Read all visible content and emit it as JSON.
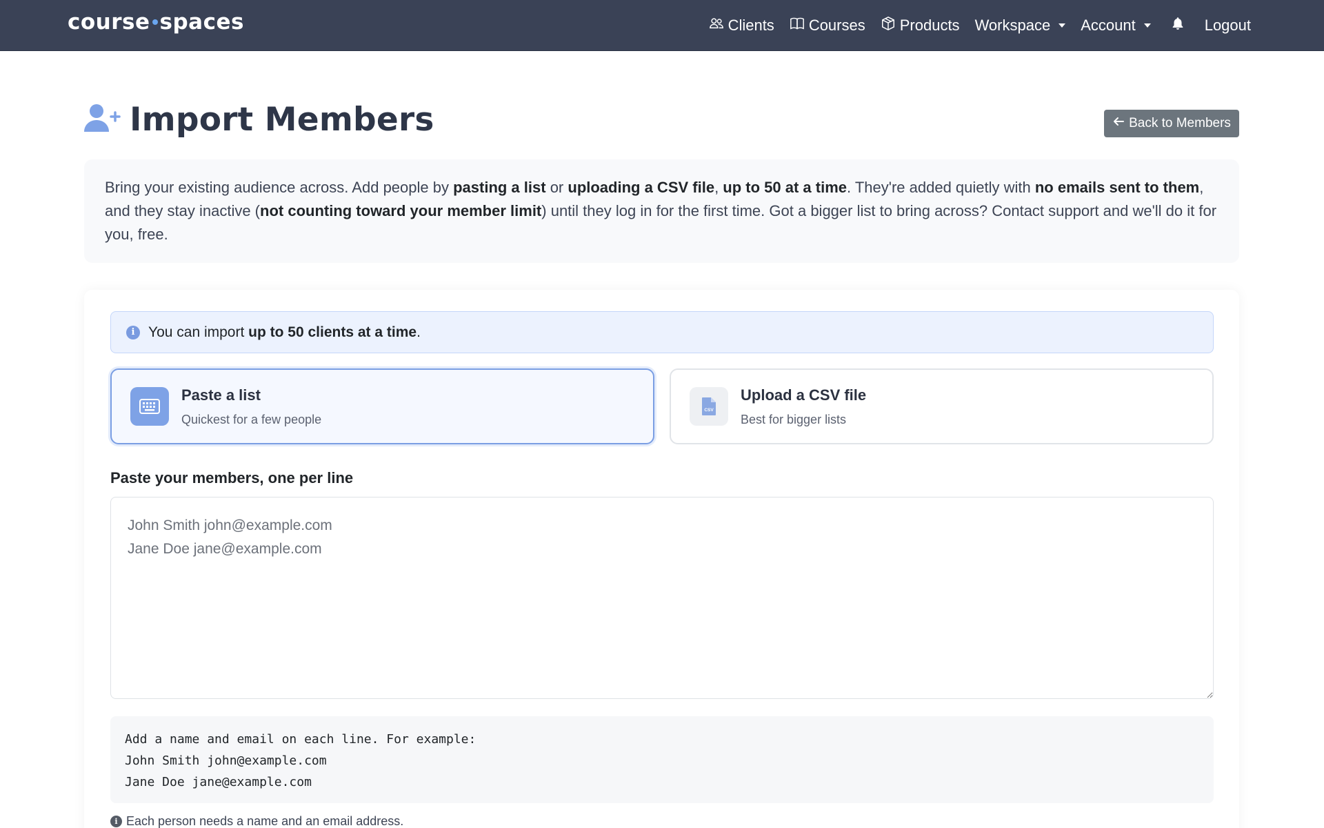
{
  "brand": {
    "left": "course",
    "right": "spaces"
  },
  "nav": {
    "clients": "Clients",
    "courses": "Courses",
    "products": "Products",
    "workspace": "Workspace",
    "account": "Account",
    "logout": "Logout"
  },
  "page": {
    "title": "Import Members",
    "back_label": "Back to Members"
  },
  "intro": {
    "t1": "Bring your existing audience across. Add people by ",
    "b1": "pasting a list",
    "t2": " or ",
    "b2": "uploading a CSV file",
    "t3": ", ",
    "b3": "up to 50 at a time",
    "t4": ". They're added quietly with ",
    "b4": "no emails sent to them",
    "t5": ", and they stay inactive (",
    "b5": "not counting toward your member limit",
    "t6": ") until they log in for the first time. Got a bigger list to bring across? Contact support and we'll do it for you, free."
  },
  "alert": {
    "prefix": "You can import ",
    "bold": "up to 50 clients at a time",
    "suffix": "."
  },
  "options": {
    "paste": {
      "title": "Paste a list",
      "subtitle": "Quickest for a few people"
    },
    "csv": {
      "title": "Upload a CSV file",
      "subtitle": "Best for bigger lists",
      "icon_text": "CSV"
    }
  },
  "paste_field": {
    "label": "Paste your members, one per line",
    "placeholder": "John Smith john@example.com\nJane Doe jane@example.com",
    "value": ""
  },
  "example": {
    "line1": "Add a name and email on each line. For example:",
    "line2": "John Smith john@example.com",
    "line3": "Jane Doe jane@example.com"
  },
  "footnote": "Each person needs a name and an email address.",
  "colors": {
    "navbar": "#3a4256",
    "accent": "#7a9ee3",
    "alert_bg": "#ecf2fe",
    "back_button": "#6c757d"
  },
  "icons": {
    "title": "user-plus-icon",
    "clients": "users-icon",
    "courses": "book-icon",
    "products": "box-icon",
    "notifications": "bell-icon",
    "back": "arrow-left-icon",
    "alert": "info-circle-icon",
    "paste": "keyboard-icon",
    "csv": "csv-file-icon"
  }
}
